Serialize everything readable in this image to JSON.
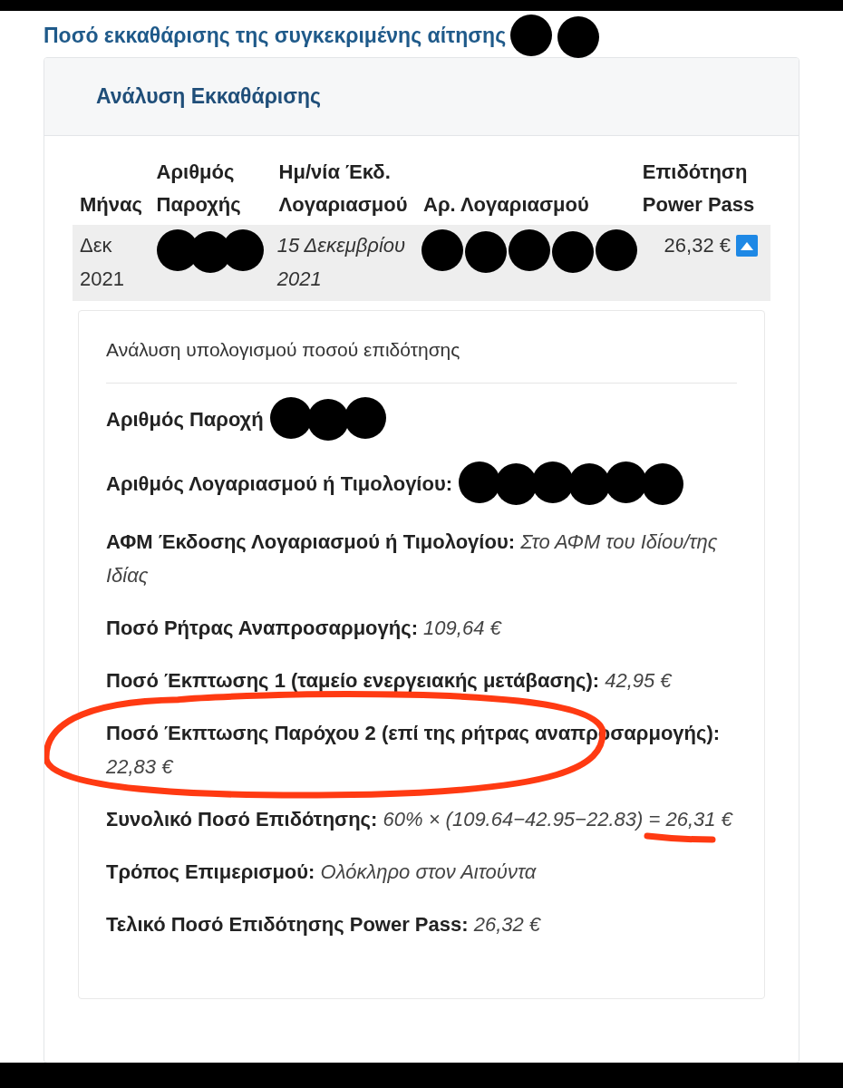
{
  "page_title": {
    "text": "Ποσό εκκαθάρισης της συγκεκριμένης αίτησης",
    "redacted": true
  },
  "card": {
    "header": "Ανάλυση Εκκαθάρισης",
    "table": {
      "columns": [
        "Μήνας",
        "Αριθμός Παροχής",
        "Ημ/νία Έκδ. Λογαριασμού",
        "Αρ. Λογαριασμού",
        "Επιδότηση Power Pass"
      ],
      "rows": [
        {
          "cells": [
            {
              "text": "Δεκ 2021",
              "redacted": false
            },
            {
              "text": "",
              "redacted": true
            },
            {
              "text": "15 Δεκεμβρίου 2021",
              "redacted": false
            },
            {
              "text": "",
              "redacted": true
            },
            {
              "text": "26,32 €",
              "redacted": false
            }
          ],
          "expanded": true
        }
      ]
    },
    "details": {
      "title": "Ανάλυση υπολογισμού ποσού επιδότησης",
      "items": [
        {
          "label": "Αριθμός Παροχή",
          "value": "",
          "redacted": true,
          "circled": false,
          "underlined": false
        },
        {
          "label": "Αριθμός Λογαριασμού ή Τιμολογίου:",
          "value": "",
          "redacted": true,
          "circled": false,
          "underlined": false
        },
        {
          "label": "ΑΦΜ Έκδοσης Λογαριασμού ή Τιμολογίου:",
          "value": "Στο ΑΦΜ του Ιδίου/της Ιδίας",
          "redacted": false,
          "circled": false,
          "underlined": false
        },
        {
          "label": "Ποσό Ρήτρας Αναπροσαρμογής:",
          "value": "109,64 €",
          "redacted": false,
          "circled": false,
          "underlined": false
        },
        {
          "label": "Ποσό Έκπτωσης 1 (ταμείο ενεργειακής μετάβασης):",
          "value": "42,95 €",
          "redacted": false,
          "circled": false,
          "underlined": false
        },
        {
          "label": "Ποσό Έκπτωσης Παρόχου 2 (επί της ρήτρας αναπροσαρμογής):",
          "value": "22,83 €",
          "redacted": false,
          "circled": true,
          "underlined": false
        },
        {
          "label": "Συνολικό Ποσό Επιδότησης:",
          "value": "60% × (109.64−42.95−22.83) = 26,31 €",
          "redacted": false,
          "circled": false,
          "underlined": true
        },
        {
          "label": "Τρόπος Επιμερισμού:",
          "value": "Ολόκληρο στον Αιτούντα",
          "redacted": false,
          "circled": false,
          "underlined": false
        },
        {
          "label": "Τελικό Ποσό Επιδότησης Power Pass:",
          "value": "26,32 €",
          "redacted": false,
          "circled": false,
          "underlined": false
        }
      ]
    }
  }
}
